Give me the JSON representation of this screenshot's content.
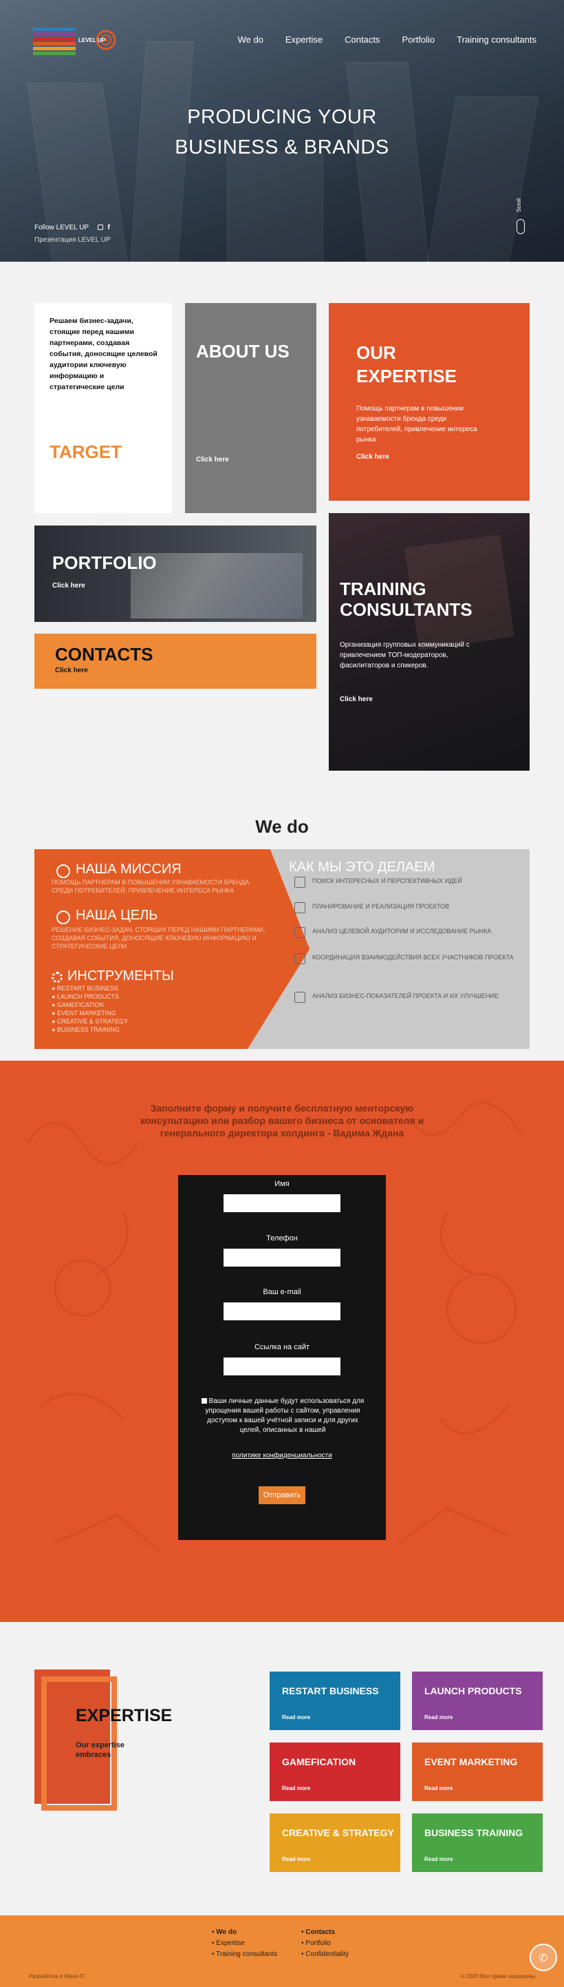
{
  "nav": {
    "items": [
      "We do",
      "Expertise",
      "Contacts",
      "Portfolio",
      "Training consultants"
    ]
  },
  "logo": {
    "text": "LEVEL UP"
  },
  "hero": {
    "title_line1": "PRODUCING YOUR",
    "title_line2": "BUSINESS & BRANDS",
    "follow": "Follow LEVEL UP",
    "presentation": "Презентация LEVEL UP",
    "scroll": "Scroll"
  },
  "tiles": {
    "target": {
      "text": "Решаем бизнес-задачи, стоящие перед нашими партнерами, создавая события, доносящие целевой аудитории ключевую информацию и стратегические цели",
      "title": "TARGET"
    },
    "about": {
      "title": "ABOUT US",
      "link": "Click here"
    },
    "expertise": {
      "title_line1": "OUR",
      "title_line2": "EXPERTISE",
      "text": "Помощь партнерам в повышении узнаваемости бренда среди потребителей, привлечение интереса рынка",
      "link": "Click here"
    },
    "portfolio": {
      "title": "PORTFOLIO",
      "link": "Click here"
    },
    "training": {
      "title_line1": "TRAINING",
      "title_line2": "CONSULTANTS",
      "text": "Организация групповых коммуникаций с привлечением ТОП-модераторов, фасилитаторов и спикеров.",
      "link": "Click here"
    },
    "contacts": {
      "title": "CONTACTS",
      "link": "Click here"
    }
  },
  "wedo": {
    "title": "We do",
    "mission_title": "Наша миссия",
    "mission_text": "Помощь партнерам в повышении узнаваемости бренда среди потребителей, привлечение интереса рынка",
    "goal_title": "Наша цель",
    "goal_text": "Решение бизнес-задач, стоящих перед нашими партнерами, создавая события, доносящие ключевую информацию и стратегические цели",
    "tools_title": "Инструменты",
    "tools": [
      "Restart business",
      "Launch products",
      "Gamefication",
      "Event marketing",
      "Creative & strategy",
      "Business training"
    ],
    "how_title": "Как мы это делаем",
    "how_items": [
      "Поиск интересных и перспективных идей",
      "Планирование и реализация проектов",
      "Анализ целевой аудитории и исследование рынка",
      "Координация взаимодействия всех участников проекта",
      "Анализ бизнес-показателей проекта и их улучшение"
    ]
  },
  "form": {
    "heading": "Заполните форму и получите бесплатную менторскую консультацию или разбор вашего бизнеса от основателя и генерального директора холдинга - Вадима Ждана",
    "name_label": "Имя",
    "phone_label": "Телефон",
    "email_label": "Ваш e-mail",
    "site_label": "Ссылка на сайт",
    "consent": "Ваши личные данные будут использоваться для упрощения вашей работы с сайтом, управления доступом к вашей учётной записи и для других целей, описанных в нашей",
    "policy": "политике конфиденциальности",
    "submit": "Отправить"
  },
  "expertise": {
    "title": "EXPERTISE",
    "subtitle_line1": "Our expertise",
    "subtitle_line2": "embraces",
    "items": [
      {
        "title": "RESTART BUSINESS",
        "link": "Read more",
        "color": "#1479a8"
      },
      {
        "title": "LAUNCH PRODUCTS",
        "link": "Read more",
        "color": "#8a4396"
      },
      {
        "title": "GAMEFICATION",
        "link": "Read more",
        "color": "#d02a2f"
      },
      {
        "title": "EVENT MARKETING",
        "link": "Read more",
        "color": "#e05a26"
      },
      {
        "title": "CREATIVE & STRATEGY",
        "link": "Read more",
        "color": "#e6a21f"
      },
      {
        "title": "BUSINESS TRAINING",
        "link": "Read more",
        "color": "#4aa545"
      }
    ]
  },
  "footer": {
    "col1": [
      "We do",
      "Expertise",
      "Training consultants"
    ],
    "col2": [
      "Contacts",
      "Portfolio",
      "Confidentiality"
    ],
    "left": "Разработка в Wave-IT",
    "right": "© 2020 Все права защищены"
  },
  "colors": {
    "orange": "#e2542a",
    "accent": "#ee8a36",
    "gray": "#7a7a7a",
    "dark": "#3a3c40"
  }
}
